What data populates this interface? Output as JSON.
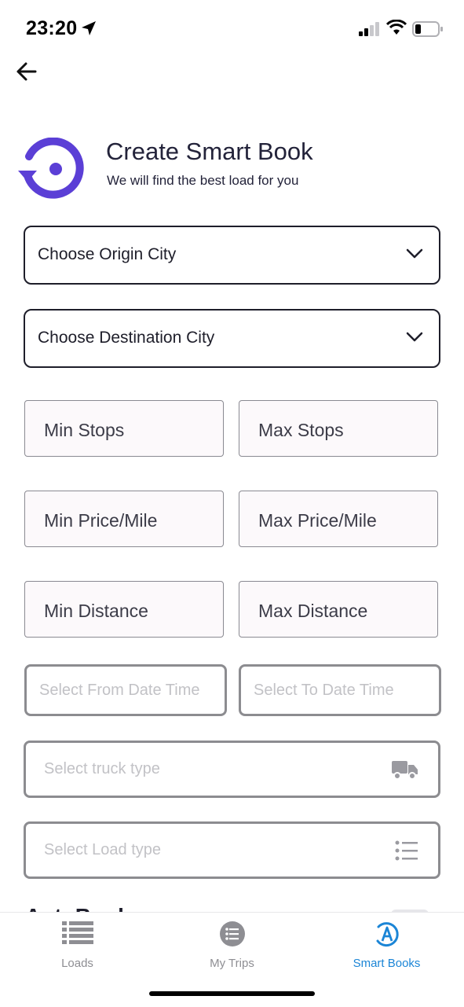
{
  "status_bar": {
    "time": "23:20"
  },
  "header": {
    "title": "Create Smart Book",
    "subtitle": "We will find the best load for you"
  },
  "form": {
    "origin_city": "Choose Origin City",
    "destination_city": "Choose Destination City",
    "min_stops": "Min Stops",
    "max_stops": "Max Stops",
    "min_price_mile": "Min Price/Mile",
    "max_price_mile": "Max Price/Mile",
    "min_distance": "Min Distance",
    "max_distance": "Max Distance",
    "from_date_placeholder": "Select From Date Time",
    "to_date_placeholder": "Select To Date Time",
    "truck_type_placeholder": "Select truck type",
    "load_type_placeholder": "Select Load type",
    "section_title": "AutoBook"
  },
  "tabbar": {
    "tabs": [
      {
        "label": "Loads",
        "icon": "list-icon"
      },
      {
        "label": "My Trips",
        "icon": "circle-list-icon"
      },
      {
        "label": "Smart Books",
        "icon": "smart-book-icon"
      }
    ],
    "active": "Smart Books"
  },
  "colors": {
    "accent": "#1b85d6",
    "logo": "#5b3fd6"
  }
}
